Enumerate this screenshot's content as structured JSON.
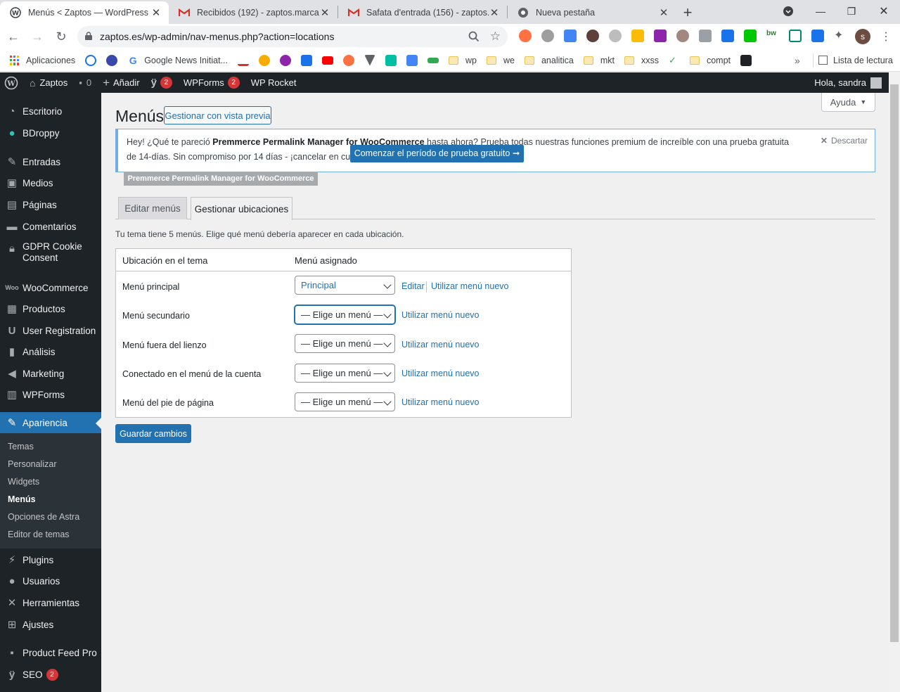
{
  "browser": {
    "tabs": [
      {
        "title": "Menús < Zaptos — WordPress",
        "active": true
      },
      {
        "title": "Recibidos (192) - zaptos.marca@",
        "active": false
      },
      {
        "title": "Safata d'entrada (156) - zaptos.m",
        "active": false
      },
      {
        "title": "Nueva pestaña",
        "active": false
      }
    ],
    "url": "zaptos.es/wp-admin/nav-menus.php?action=locations",
    "bookmarks": {
      "apps": "Aplicaciones",
      "google_news": "Google News Initiat...",
      "folders": [
        "wp",
        "we",
        "analitica",
        "mkt",
        "xxss",
        "compt"
      ],
      "reading_list": "Lista de lectura"
    },
    "profile_initial": "s"
  },
  "adminbar": {
    "site_name": "Zaptos",
    "comments_count": "0",
    "add_new": "Añadir",
    "yoast_count": "2",
    "wpforms": "WPForms",
    "wpforms_count": "2",
    "wprocket": "WP Rocket",
    "greeting": "Hola, sandra"
  },
  "sidebar": {
    "items": [
      {
        "label": "Escritorio"
      },
      {
        "label": "BDroppy"
      },
      {
        "label": "Entradas"
      },
      {
        "label": "Medios"
      },
      {
        "label": "Páginas"
      },
      {
        "label": "Comentarios"
      },
      {
        "label": "GDPR Cookie Consent"
      },
      {
        "label": "WooCommerce"
      },
      {
        "label": "Productos"
      },
      {
        "label": "User Registration"
      },
      {
        "label": "Análisis"
      },
      {
        "label": "Marketing"
      },
      {
        "label": "WPForms"
      },
      {
        "label": "Apariencia"
      },
      {
        "label": "Plugins"
      },
      {
        "label": "Usuarios"
      },
      {
        "label": "Herramientas"
      },
      {
        "label": "Ajustes"
      },
      {
        "label": "Product Feed Pro"
      },
      {
        "label": "SEO",
        "badge": "2"
      }
    ],
    "submenu": [
      "Temas",
      "Personalizar",
      "Widgets",
      "Menús",
      "Opciones de Astra",
      "Editor de temas"
    ]
  },
  "page": {
    "title": "Menús",
    "preview_button": "Gestionar con vista previa",
    "help": "Ayuda",
    "notice": {
      "text_pre": "Hey! ¿Qué te pareció ",
      "plugin_name": "Premmerce Permalink Manager for WooCommerce",
      "text_post": " hasta ahora? Prueba todas nuestras funciones premium de increíble con una prueba gratuita de 14-días. Sin compromiso por 14 días - ¡cancelar en cualquier momento!",
      "cta": "Comenzar el período de prueba gratuito ➞",
      "dismiss": "Descartar"
    },
    "plugin_tag": "Premmerce Permalink Manager for WooCommerce",
    "tabs": [
      "Editar menús",
      "Gestionar ubicaciones"
    ],
    "description": "Tu tema tiene 5 menús. Elige qué menú debería aparecer en cada ubicación.",
    "table": {
      "headers": [
        "Ubicación en el tema",
        "Menú asignado"
      ],
      "rows": [
        {
          "location": "Menú principal",
          "menu": "Principal",
          "edit": "Editar",
          "new": "Utilizar menú nuevo"
        },
        {
          "location": "Menú secundario",
          "menu": "— Elige un menú —",
          "new": "Utilizar menú nuevo"
        },
        {
          "location": "Menú fuera del lienzo",
          "menu": "— Elige un menú —",
          "new": "Utilizar menú nuevo"
        },
        {
          "location": "Conectado en el menú de la cuenta",
          "menu": "— Elige un menú —",
          "new": "Utilizar menú nuevo"
        },
        {
          "location": "Menú del pie de página",
          "menu": "— Elige un menú —",
          "new": "Utilizar menú nuevo"
        }
      ]
    },
    "save": "Guardar cambios"
  }
}
